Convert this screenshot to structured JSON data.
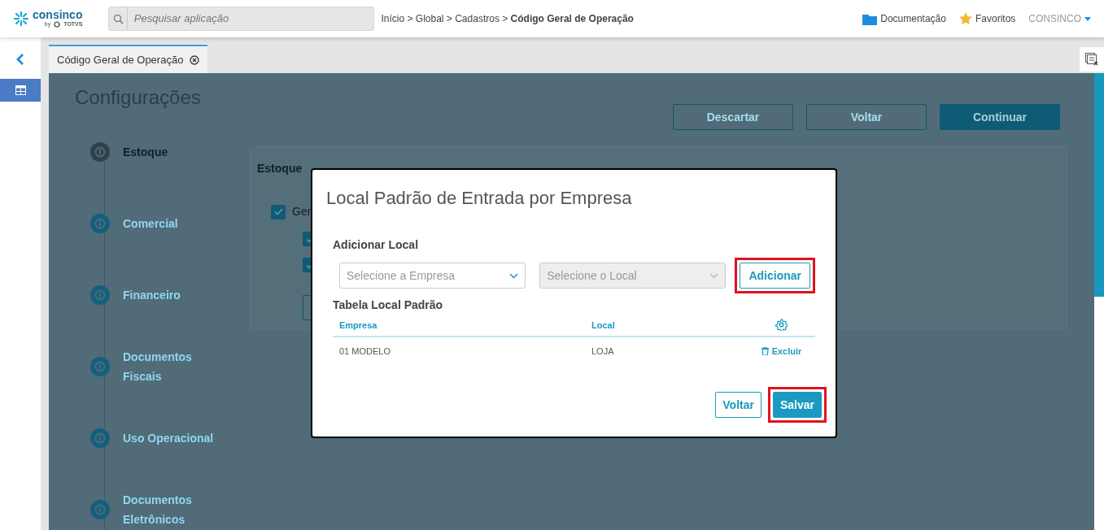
{
  "header": {
    "logo": {
      "brand": "consinco",
      "by": "by",
      "partner": "TOTVS"
    },
    "search": {
      "placeholder": "Pesquisar aplicação"
    },
    "breadcrumb": "Início > Global > Cadastros > **Código Geral de Operação**",
    "links": [
      "Documentação",
      "Favoritos"
    ],
    "user": "CONSINCO"
  },
  "sidebar": {
    "items": [
      {
        "selected": true
      }
    ]
  },
  "tabs": [
    {
      "label": "Código Geral de Operação",
      "selected": true
    }
  ],
  "page": {
    "title": "Configurações",
    "actions": [
      {
        "label": "Descartar",
        "kind": "outline"
      },
      {
        "label": "Voltar",
        "kind": "outline"
      },
      {
        "label": "Continuar",
        "kind": "filled"
      }
    ],
    "steps": [
      {
        "label": "Estoque",
        "active": true
      },
      {
        "label": "Comercial",
        "active": false
      },
      {
        "label": "Financeiro",
        "active": false
      },
      {
        "label": "Documentos Fiscais",
        "active": false
      },
      {
        "label": "Uso Operacional",
        "active": false
      },
      {
        "label": "Documentos Eletrônicos",
        "active": false
      }
    ],
    "card": {
      "title": "Estoque",
      "checks": [
        {
          "label": "Ger",
          "checked": true
        },
        {
          "checked": true
        },
        {
          "checked": true
        }
      ]
    }
  },
  "modal": {
    "title": "Local Padrão de Entrada por Empresa",
    "add_label": "Adicionar Local",
    "selects": [
      {
        "placeholder": "Selecione a Empresa",
        "disabled": false
      },
      {
        "placeholder": "Selecione o Local",
        "disabled": true
      }
    ],
    "add_button": {
      "label": "Adicionar",
      "highlighted": true
    },
    "table_label": "Tabela Local Padrão",
    "columns": [
      "Empresa",
      "Local"
    ],
    "rows": [
      {
        "empresa": "01 MODELO",
        "local": "LOJA",
        "action": "Excluir"
      }
    ],
    "footer": [
      {
        "label": "Voltar",
        "kind": "outline",
        "highlighted": false
      },
      {
        "label": "Salvar",
        "kind": "filled",
        "highlighted": true
      }
    ]
  }
}
